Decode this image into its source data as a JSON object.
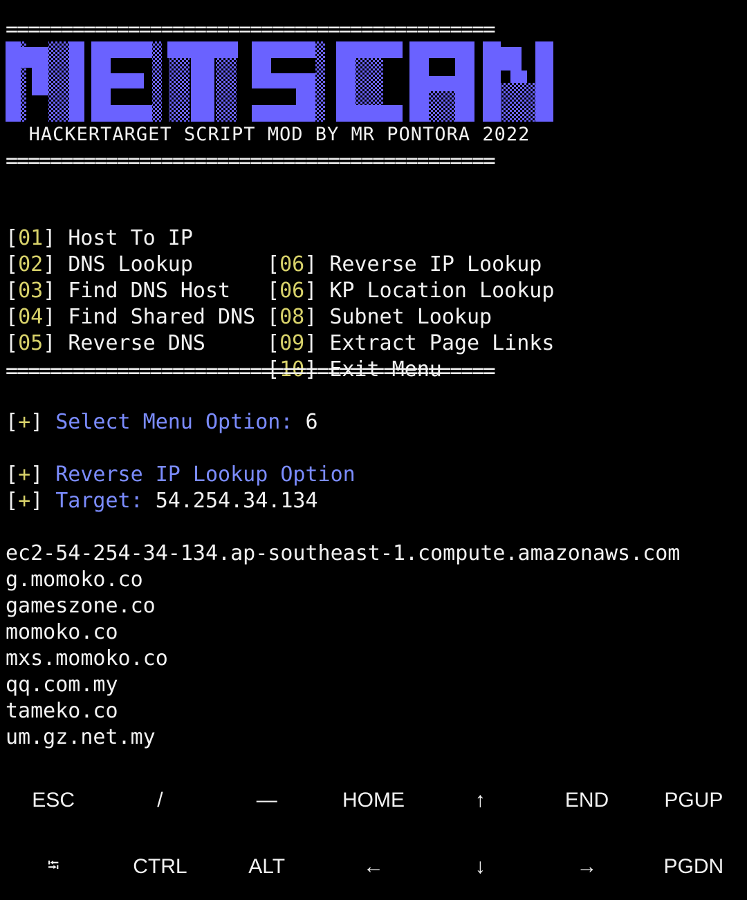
{
  "rule": "============================================",
  "logo_text": "NETSCAN",
  "subtitle": "HACKERTARGET SCRIPT MOD BY MR PONTORA 2022",
  "menu": {
    "left": [
      {
        "num": "01",
        "label": "Host To IP"
      },
      {
        "num": "02",
        "label": "DNS Lookup"
      },
      {
        "num": "03",
        "label": "Find DNS Host"
      },
      {
        "num": "04",
        "label": "Find Shared DNS"
      },
      {
        "num": "05",
        "label": "Reverse DNS"
      }
    ],
    "right": [
      {
        "num": "06",
        "label": "Reverse IP Lookup"
      },
      {
        "num": "06",
        "label": "KP Location Lookup"
      },
      {
        "num": "08",
        "label": "Subnet Lookup"
      },
      {
        "num": "09",
        "label": "Extract Page Links"
      },
      {
        "num": "10",
        "label": "Exit Menu"
      }
    ]
  },
  "prompt": {
    "plus": "+",
    "select_label": "Select Menu Option:",
    "select_value": "6",
    "option_label": "Reverse IP Lookup Option",
    "target_label": "Target:",
    "target_value": "54.254.34.134"
  },
  "results": [
    "ec2-54-254-34-134.ap-southeast-1.compute.amazonaws.com",
    "g.momoko.co",
    "gameszone.co",
    "momoko.co",
    "mxs.momoko.co",
    "qq.com.my",
    "tameko.co",
    "um.gz.net.my"
  ],
  "keys": {
    "row1": [
      "ESC",
      "/",
      "—",
      "HOME",
      "↑",
      "END",
      "PGUP"
    ],
    "row2": [
      "⭾",
      "CTRL",
      "ALT",
      "←",
      "↓",
      "→",
      "PGDN"
    ]
  },
  "colors": {
    "background": "#000000",
    "text": "#f2f2f2",
    "logo": "#6a62ff",
    "number": "#d8d26a",
    "label": "#7b8cff"
  }
}
